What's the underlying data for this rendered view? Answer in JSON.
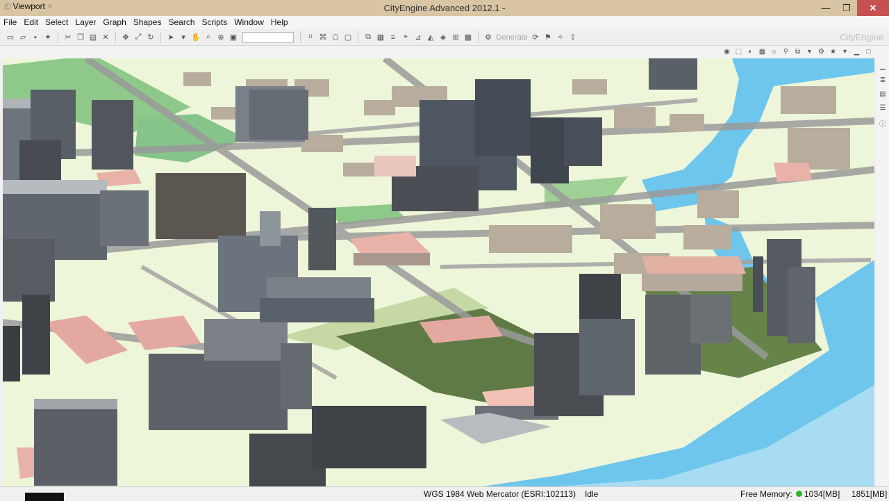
{
  "window": {
    "title": "CityEngine Advanced 2012.1 -",
    "minimize": "—",
    "maximize": "❐",
    "close": "✕"
  },
  "menu": [
    "File",
    "Edit",
    "Select",
    "Layer",
    "Graph",
    "Shapes",
    "Search",
    "Scripts",
    "Window",
    "Help"
  ],
  "toolbar": {
    "generate_label": "Generate",
    "brand": "CityEngine"
  },
  "viewport_tab": {
    "label": "Viewport"
  },
  "status": {
    "crs": "WGS 1984 Web Mercator (ESRI:102113)",
    "state": "Idle",
    "memory_label": "Free Memory:",
    "memory_used": "1034[MB]",
    "memory_total": "1851[MB]"
  },
  "colors": {
    "water": "#6fc6ec",
    "ground": "#eef6d9",
    "grass": "#8ec98a",
    "road": "#9a9a9a",
    "roof": "#e8b2a8",
    "building": "#707a84",
    "status_ok": "#2bb52b"
  }
}
